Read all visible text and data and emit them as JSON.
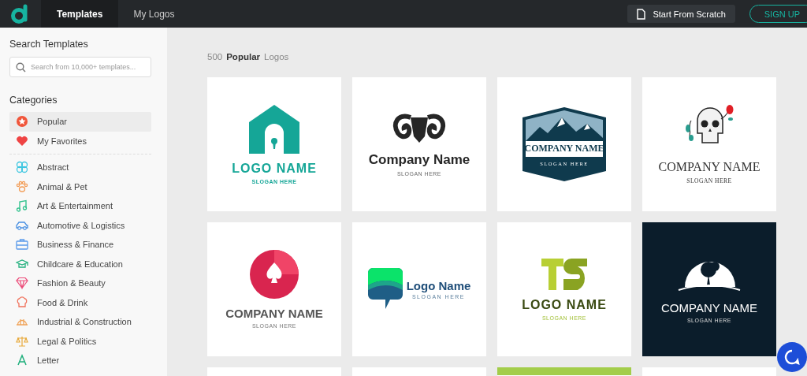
{
  "topbar": {
    "tabs": [
      {
        "label": "Templates",
        "selected": true
      },
      {
        "label": "My Logos",
        "selected": false
      }
    ],
    "scratch_button": "Start From Scratch",
    "signup_button": "SIGN UP"
  },
  "sidebar": {
    "search_title": "Search Templates",
    "search": {
      "placeholder": "Search from 10,000+ templates..."
    },
    "categories_title": "Categories",
    "pinned": [
      {
        "label": "Popular",
        "selected": true
      },
      {
        "label": "My Favorites",
        "selected": false
      }
    ],
    "items": [
      {
        "label": "Abstract",
        "selected": false
      },
      {
        "label": "Animal & Pet",
        "selected": false
      },
      {
        "label": "Art & Entertainment",
        "selected": false
      },
      {
        "label": "Automotive & Logistics",
        "selected": false
      },
      {
        "label": "Business & Finance",
        "selected": false
      },
      {
        "label": "Childcare & Education",
        "selected": false
      },
      {
        "label": "Fashion & Beauty",
        "selected": false
      },
      {
        "label": "Food & Drink",
        "selected": false
      },
      {
        "label": "Industrial & Construction",
        "selected": false
      },
      {
        "label": "Legal & Politics",
        "selected": false
      },
      {
        "label": "Letter",
        "selected": false
      }
    ]
  },
  "main": {
    "count": "500",
    "category": "Popular",
    "suffix": "Logos",
    "logos": [
      {
        "kind": "house",
        "name": "LOGO NAME",
        "slogan": "SLOGAN HERE"
      },
      {
        "kind": "ram",
        "name": "Company Name",
        "slogan": "SLOGAN HERE"
      },
      {
        "kind": "mountain",
        "name": "COMPANY NAME",
        "slogan": "SLOGAN HERE"
      },
      {
        "kind": "skull",
        "name": "COMPANY NAME",
        "slogan": "SLOGAN HERE"
      },
      {
        "kind": "spade",
        "name": "COMPANY NAME",
        "slogan": "SLOGAN HERE"
      },
      {
        "kind": "chat",
        "name": "Logo Name",
        "slogan": "SLOGAN HERE"
      },
      {
        "kind": "ts",
        "name": "LOGO NAME",
        "slogan": "SLOGAN HERE"
      },
      {
        "kind": "tree",
        "name": "COMPANY NAME",
        "slogan": "SLOGAN HERE"
      },
      {
        "kind": "blank"
      },
      {
        "kind": "blank"
      },
      {
        "kind": "green"
      },
      {
        "kind": "blank"
      }
    ]
  }
}
